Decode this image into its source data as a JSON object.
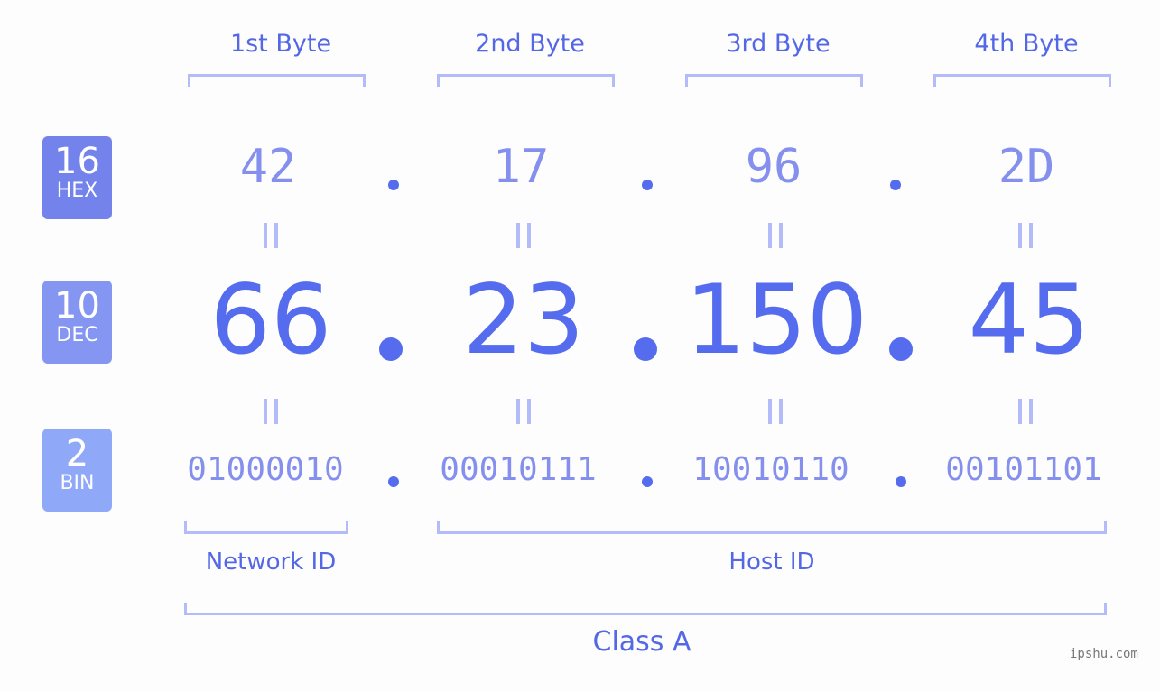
{
  "bytes": [
    {
      "label": "1st Byte",
      "hex": "42",
      "dec": "66",
      "bin": "01000010"
    },
    {
      "label": "2nd Byte",
      "hex": "17",
      "dec": "23",
      "bin": "00010111"
    },
    {
      "label": "3rd Byte",
      "hex": "96",
      "dec": "150",
      "bin": "10010110"
    },
    {
      "label": "4th Byte",
      "hex": "2D",
      "dec": "45",
      "bin": "00101101"
    }
  ],
  "badges": {
    "hex": {
      "number": "16",
      "label": "HEX",
      "color": "#7383eb"
    },
    "dec": {
      "number": "10",
      "label": "DEC",
      "color": "#8495f2"
    },
    "bin": {
      "number": "2",
      "label": "BIN",
      "color": "#8fa8f8"
    }
  },
  "separator": ".",
  "network_id_label": "Network ID",
  "host_id_label": "Host ID",
  "class_label": "Class A",
  "watermark": "ipshu.com",
  "colors": {
    "accent": "#556cef",
    "light_accent": "#8590ee",
    "bracket": "#b3bcf8",
    "background": "#fcfdfc"
  }
}
